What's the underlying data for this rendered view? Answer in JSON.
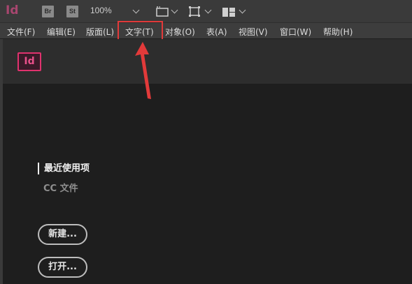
{
  "app": {
    "logo_text": "Id",
    "bridge_label": "Br",
    "stock_label": "St",
    "zoom_level": "100%"
  },
  "menu": {
    "items": [
      {
        "label": "文件(F)"
      },
      {
        "label": "编辑(E)"
      },
      {
        "label": "版面(L)"
      },
      {
        "label": "文字(T)"
      },
      {
        "label": "对象(O)"
      },
      {
        "label": "表(A)"
      },
      {
        "label": "视图(V)"
      },
      {
        "label": "窗口(W)"
      },
      {
        "label": "帮助(H)"
      }
    ],
    "highlighted_item": "文字(T)"
  },
  "welcome": {
    "logo_text": "Id",
    "recent_heading": "最近使用项",
    "cc_files": "CC 文件",
    "new_button": "新建...",
    "open_button": "打开..."
  },
  "colors": {
    "accent": "#e0326e",
    "annotation": "#e23a3a",
    "background": "#1e1e1e"
  },
  "icons": [
    "screen-mode-icon",
    "frame-fit-icon",
    "workspace-layout-icon",
    "chevron-down-icon",
    "annotation-arrow"
  ]
}
